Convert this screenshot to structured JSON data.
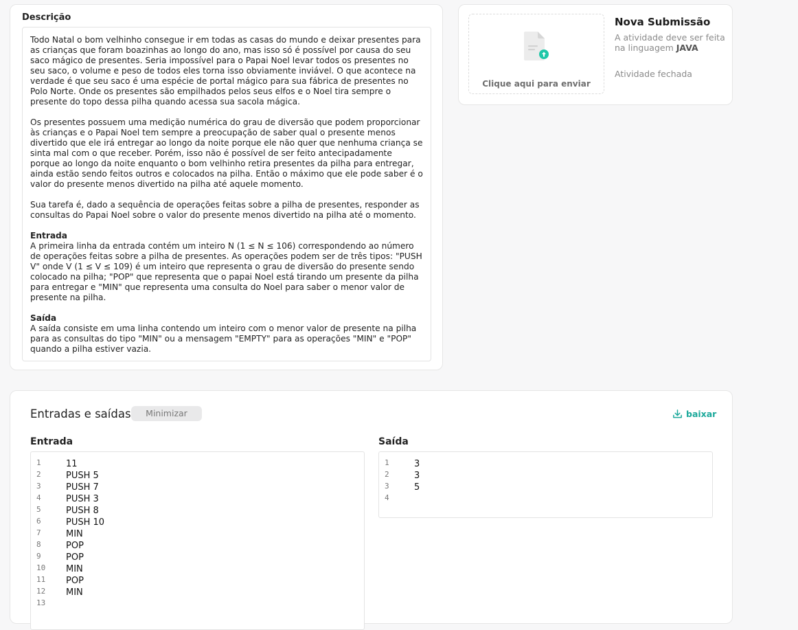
{
  "description": {
    "title": "Descrição",
    "paragraphs": [
      "Todo Natal o bom velhinho consegue ir em todas as casas do mundo e deixar presentes para as crianças que foram boazinhas ao longo do ano, mas isso só é possível por causa do seu saco mágico de presentes. Seria impossível para o Papai Noel levar todos os presentes no seu saco, o volume e peso de todos eles torna isso obviamente inviável. O que acontece na verdade é que seu saco é uma espécie de portal mágico para sua fábrica de presentes no Polo Norte. Onde os presentes são empilhados pelos seus elfos e o Noel tira sempre o presente do topo dessa pilha quando acessa sua sacola mágica.",
      "Os presentes possuem uma medição numérica do grau de diversão que podem proporcionar às crianças e o Papai Noel tem sempre a preocupação de saber qual o presente menos divertido que ele irá entregar ao longo da noite porque ele não quer que nenhuma criança se sinta mal com o que receber. Porém, isso não é possível de ser feito antecipadamente porque ao longo da noite enquanto o bom velhinho retira presentes da pilha para entregar, ainda estão sendo feitos outros e colocados na pilha. Então o máximo que ele pode saber é o valor do presente menos divertido na pilha até aquele momento.",
      "Sua tarefa é, dado a sequência de operações feitas sobre a pilha de presentes, responder as consultas do Papai Noel sobre o valor do presente menos divertido na pilha até o momento."
    ],
    "input_heading": "Entrada",
    "input_text": "A primeira linha da entrada contém um inteiro N (1 ≤ N ≤ 106) correspondendo ao número de operações feitas sobre a pilha de presentes. As operações podem ser de três tipos: \"PUSH V\" onde V (1 ≤ V ≤ 109) é um inteiro que representa o grau de diversão do presente sendo colocado na pilha; \"POP\" que representa que o papai Noel está tirando um presente da pilha para entregar e \"MIN\" que representa uma consulta do Noel para saber o menor valor de presente na pilha.",
    "output_heading": "Saída",
    "output_text": "A saída consiste em uma linha contendo um inteiro com o menor valor de presente na pilha para as consultas do tipo \"MIN\" ou a mensagem \"EMPTY\" para as operações \"MIN\" e \"POP\" quando a pilha estiver vazia."
  },
  "submission": {
    "upload_label": "Clique aqui para enviar",
    "upload_icon": "file-upload-icon",
    "title": "Nova Submissão",
    "info_prefix": "A atividade deve ser feita na linguagem ",
    "language": "JAVA",
    "status": "Atividade fechada",
    "accent_color": "#1fc7a8"
  },
  "io": {
    "title": "Entradas e saídas",
    "minimize_label": "Minimizar",
    "download_label": "baixar",
    "download_icon": "download-icon",
    "link_color": "#1aa89a",
    "input_label": "Entrada",
    "output_label": "Saída",
    "input_lines": [
      "11",
      "PUSH 5",
      "PUSH 7",
      "PUSH 3",
      "PUSH 8",
      "PUSH 10",
      "MIN",
      "POP",
      "POP",
      "MIN",
      "POP",
      "MIN",
      ""
    ],
    "output_lines": [
      "3",
      "3",
      "5",
      ""
    ]
  }
}
